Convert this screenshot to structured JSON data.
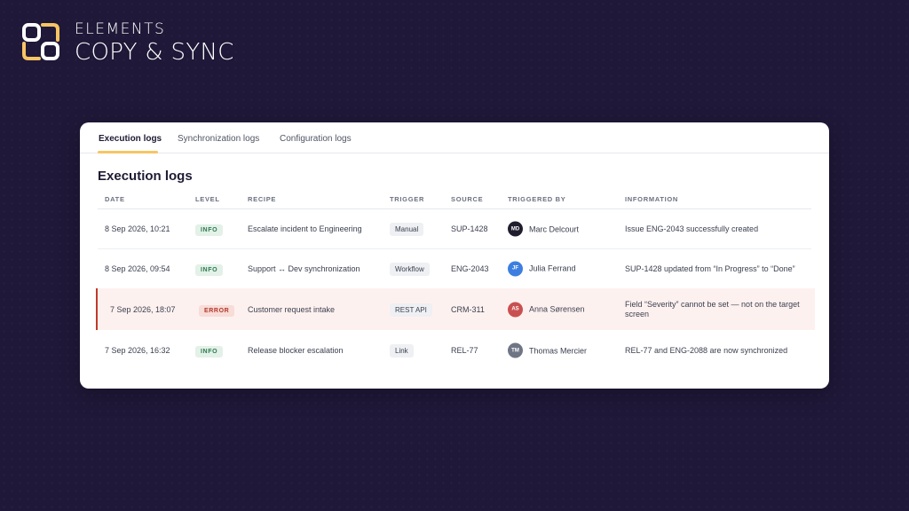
{
  "brand": {
    "top": "ELEMENTS",
    "bottom": "COPY & SYNC",
    "colors": {
      "yellow": "#f7c564",
      "white": "#ffffff"
    }
  },
  "tabs": [
    {
      "label": "Execution logs",
      "active": true
    },
    {
      "label": "Synchronization logs",
      "active": false
    },
    {
      "label": "Configuration logs",
      "active": false
    }
  ],
  "page_title": "Execution logs",
  "columns": [
    "DATE",
    "LEVEL",
    "RECIPE",
    "TRIGGER",
    "SOURCE",
    "TRIGGERED BY",
    "INFORMATION"
  ],
  "rows": [
    {
      "date": "8 Sep 2026, 10:21",
      "level": "INFO",
      "recipe": "Escalate incident to Engineering",
      "trigger": "Manual",
      "source": "SUP-1428",
      "user_initials": "MD",
      "user_name": "Marc Delcourt",
      "user_color": "#1f1d2e",
      "information": "Issue ENG-2043 successfully created"
    },
    {
      "date": "8 Sep 2026, 09:54",
      "level": "INFO",
      "recipe": "Support ↔ Dev synchronization",
      "trigger": "Workflow",
      "source": "ENG-2043",
      "user_initials": "JF",
      "user_name": "Julia Ferrand",
      "user_color": "#3d7fe0",
      "information": "SUP-1428 updated from “In Progress” to “Done”"
    },
    {
      "date": "7 Sep 2026, 18:07",
      "level": "ERROR",
      "recipe": "Customer request intake",
      "trigger": "REST API",
      "source": "CRM-311",
      "user_initials": "AS",
      "user_name": "Anna Sørensen",
      "user_color": "#c95050",
      "information": "Field “Severity” cannot be set — not on the target screen"
    },
    {
      "date": "7 Sep 2026, 16:32",
      "level": "INFO",
      "recipe": "Release blocker escalation",
      "trigger": "Link",
      "source": "REL-77",
      "user_initials": "TM",
      "user_name": "Thomas Mercier",
      "user_color": "#6f7585",
      "information": "REL-77 and ENG-2088 are now synchronized"
    }
  ]
}
